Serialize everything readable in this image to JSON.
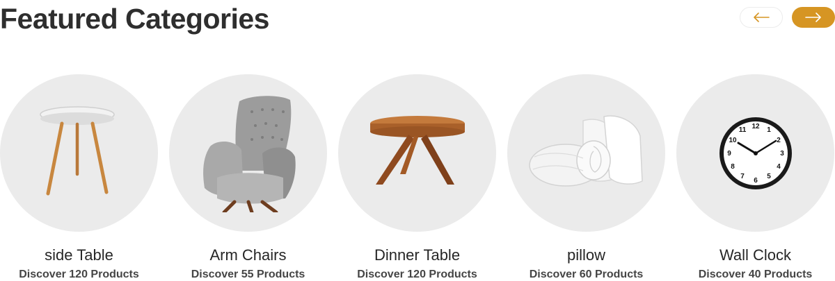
{
  "header": {
    "title": "Featured Categories"
  },
  "nav": {
    "prev_icon": "arrow-left-icon",
    "next_icon": "arrow-right-icon",
    "accent_color": "#d69523"
  },
  "categories": [
    {
      "name": "side Table",
      "count": "Discover 120 Products",
      "icon": "side-table-icon"
    },
    {
      "name": "Arm Chairs",
      "count": "Discover 55 Products",
      "icon": "arm-chair-icon"
    },
    {
      "name": "Dinner Table",
      "count": "Discover 120 Products",
      "icon": "dinner-table-icon"
    },
    {
      "name": "pillow",
      "count": "Discover 60 Products",
      "icon": "pillow-icon"
    },
    {
      "name": "Wall Clock",
      "count": "Discover 40 Products",
      "icon": "wall-clock-icon"
    }
  ]
}
